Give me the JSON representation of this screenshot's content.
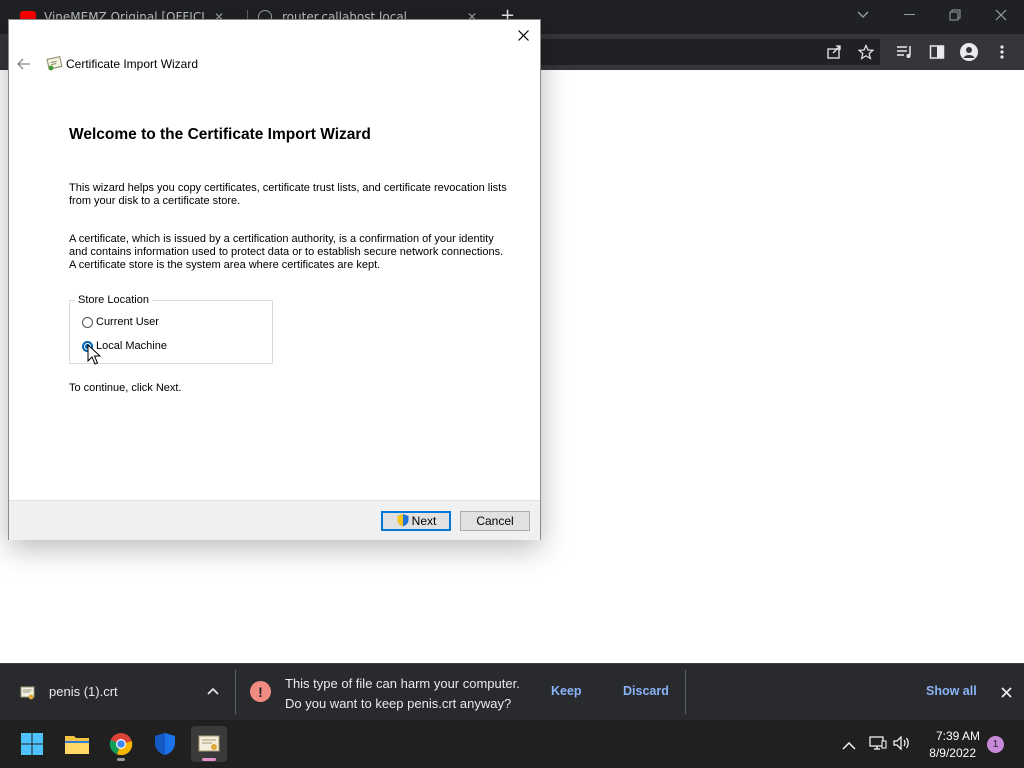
{
  "browser": {
    "tabs": [
      {
        "title": "VineMEMZ Original [OFFICIAL] F",
        "close": "✕"
      },
      {
        "title": "router.callahost.local",
        "close": "✕"
      }
    ],
    "new_tab": "+"
  },
  "dialog": {
    "title": "Certificate Import Wizard",
    "heading": "Welcome to the Certificate Import Wizard",
    "paragraph1": "This wizard helps you copy certificates, certificate trust lists, and certificate revocation lists from your disk to a certificate store.",
    "paragraph2": "A certificate, which is issued by a certification authority, is a confirmation of your identity and contains information used to protect data or to establish secure network connections. A certificate store is the system area where certificates are kept.",
    "store_location": {
      "legend": "Store Location",
      "options": [
        {
          "label": "Current User",
          "checked": false
        },
        {
          "label": "Local Machine",
          "checked": true
        }
      ]
    },
    "continue_text": "To continue, click Next.",
    "next_label": "Next",
    "cancel_label": "Cancel"
  },
  "download_bar": {
    "filename": "penis (1).crt",
    "warning_line1": "This type of file can harm your computer.",
    "warning_line2": "Do you want to keep penis.crt anyway?",
    "keep_label": "Keep",
    "discard_label": "Discard",
    "show_all_label": "Show all",
    "warning_color": "#f28b82",
    "link_color": "#8ab4f8"
  },
  "taskbar": {
    "apps": [
      "start-icon",
      "file-explorer-icon",
      "chrome-icon",
      "windows-security-icon",
      "certificate-app-icon"
    ],
    "time": "7:39 AM",
    "date": "8/9/2022",
    "notification_count": "1"
  }
}
